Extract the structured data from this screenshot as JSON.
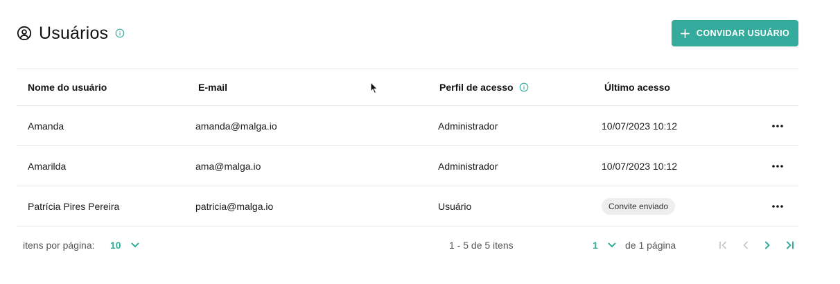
{
  "header": {
    "title": "Usuários",
    "invite_label": "CONVIDAR USUÁRIO"
  },
  "table": {
    "columns": {
      "name": "Nome do usuário",
      "email": "E-mail",
      "profile": "Perfil de acesso",
      "last_access": "Último acesso"
    },
    "rows": [
      {
        "name": "Amanda",
        "email": "amanda@malga.io",
        "profile": "Administrador",
        "last_access": "10/07/2023 10:12"
      },
      {
        "name": "Amarilda",
        "email": "ama@malga.io",
        "profile": "Administrador",
        "last_access": "10/07/2023 10:12"
      },
      {
        "name": "Patrícia Pires Pereira",
        "email": "patricia@malga.io",
        "profile": "Usuário",
        "last_access_badge": "Convite enviado"
      }
    ]
  },
  "pagination": {
    "per_page_label": "itens por página:",
    "per_page_value": "10",
    "range_text": "1 - 5 de 5 itens",
    "current_page": "1",
    "page_of_text": "de 1 página"
  },
  "icons": {
    "title": "user-circle-icon",
    "title_info": "info-icon",
    "invite": "plus-icon",
    "profile_info": "info-icon",
    "row_actions": "more-horizontal-icon",
    "dropdown": "chevron-down-icon",
    "first": "chevrons-left-icon",
    "prev": "chevron-left-icon",
    "next": "chevron-right-icon",
    "last": "chevrons-right-icon"
  },
  "colors": {
    "accent": "#34ab9c",
    "accent_light": "#6cc5bb",
    "disabled": "#c8c8c8",
    "badge_bg": "#eeeeee",
    "border": "#e6e6e6"
  }
}
